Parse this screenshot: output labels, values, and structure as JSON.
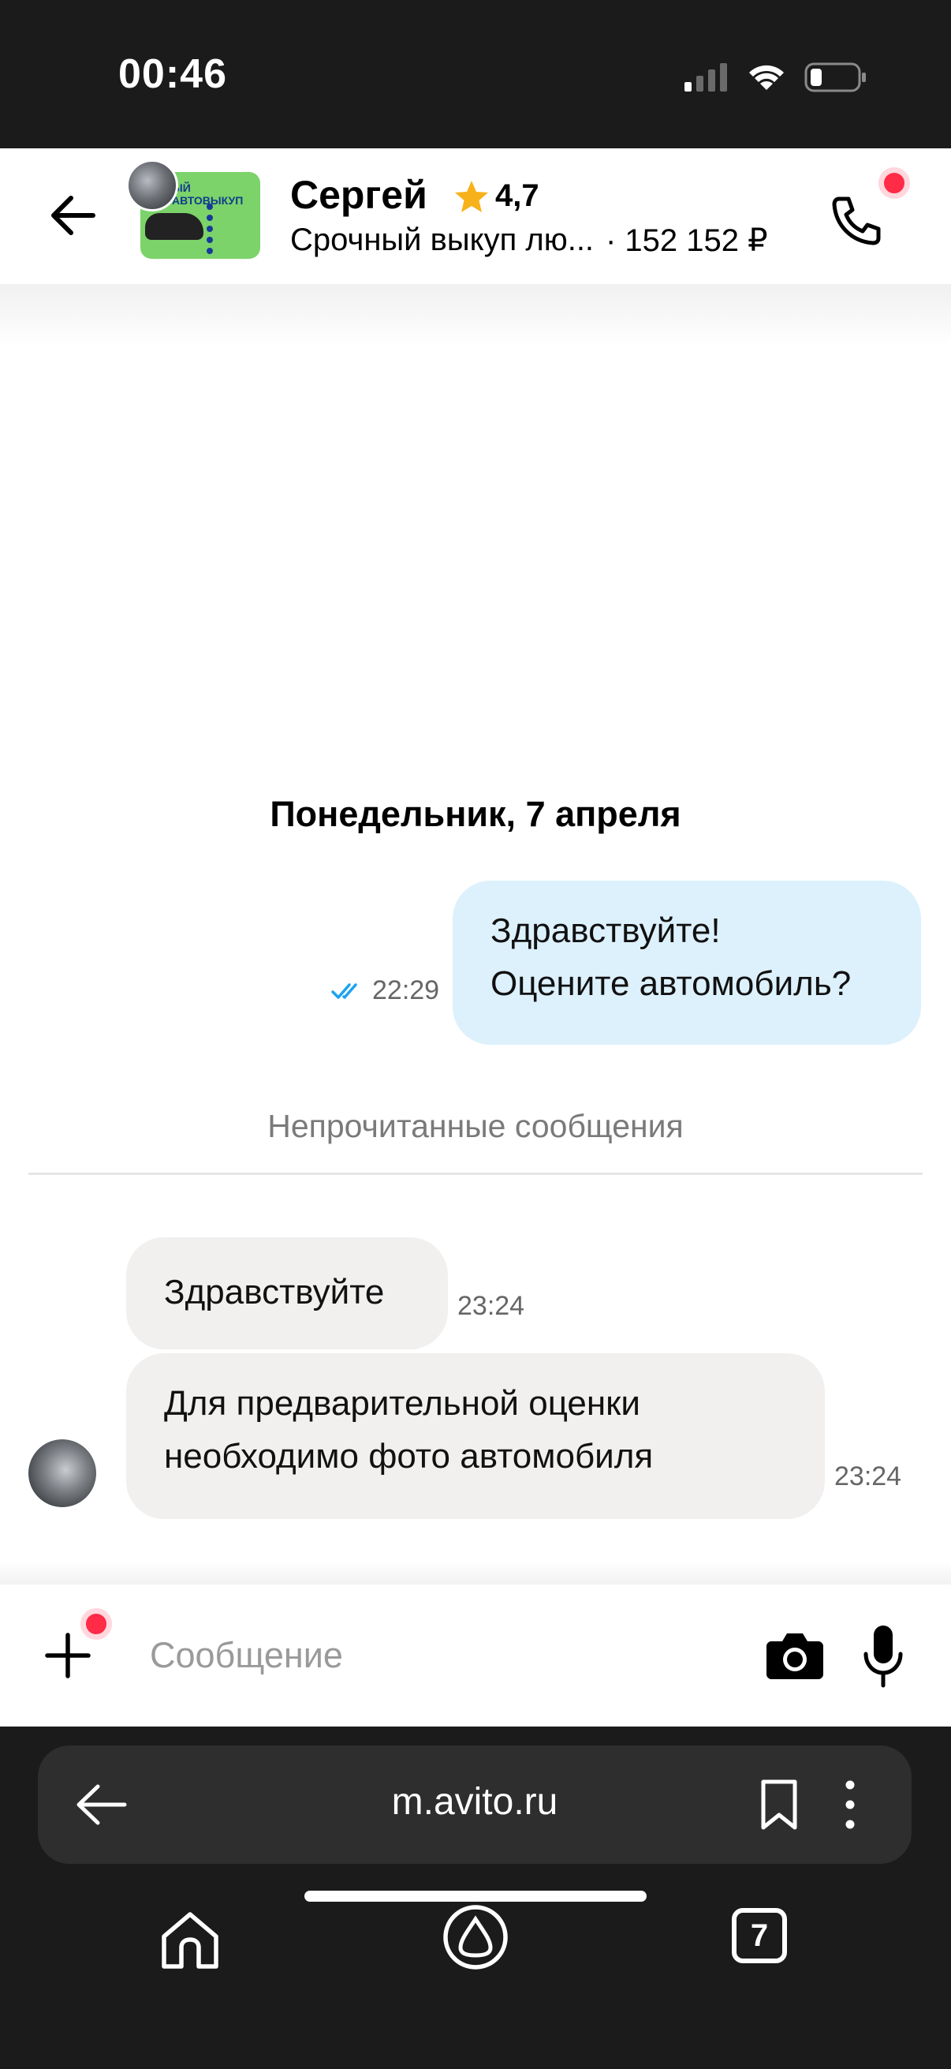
{
  "status_bar": {
    "time": "00:46",
    "icons": [
      "cellular-signal-icon",
      "wifi-icon",
      "battery-icon"
    ]
  },
  "header": {
    "seller_name": "Сергей",
    "rating": "4,7",
    "item_title": "Срочный выкуп лю...",
    "item_price": "· 152 152 ₽",
    "thumbnail_banner": "ЫЙ АВТОВЫКУП",
    "accent_color": "#ff2b47",
    "star_color": "#f7b21b"
  },
  "chat": {
    "date_separator": "Понедельник, 7 апреля",
    "outgoing": [
      {
        "lines": [
          "Здравствуйте!",
          "Оцените автомобиль?"
        ],
        "time": "22:29",
        "status": "read"
      }
    ],
    "unread_label": "Непрочитанные сообщения",
    "incoming": [
      {
        "lines": [
          "Здравствуйте"
        ],
        "time": "23:24"
      },
      {
        "lines": [
          "Для предварительной оценки",
          "необходимо фото автомобиля"
        ],
        "time": "23:24"
      }
    ],
    "outgoing_bubble_color": "#ddf1fd",
    "incoming_bubble_color": "#f1f0ef",
    "read_check_color": "#1aa3f0"
  },
  "composer": {
    "placeholder": "Сообщение",
    "value": ""
  },
  "browser": {
    "url": "m.avito.ru",
    "tab_count": "7"
  }
}
